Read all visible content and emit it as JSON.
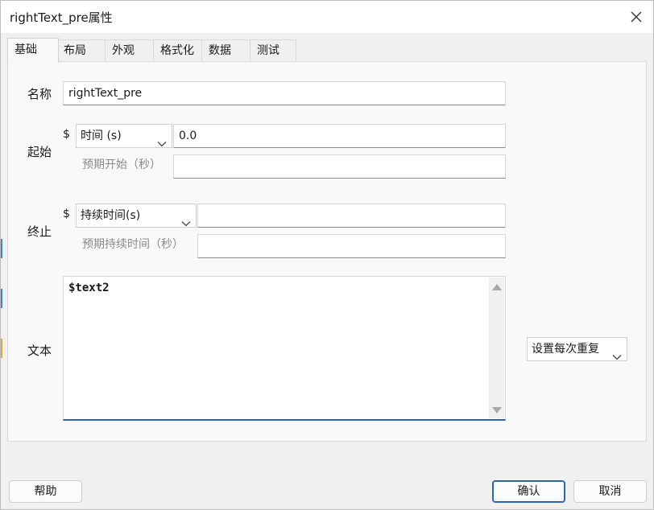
{
  "window": {
    "title": "rightText_pre属性"
  },
  "tabs": [
    {
      "label": "基础",
      "active": true
    },
    {
      "label": "布局"
    },
    {
      "label": "外观"
    },
    {
      "label": "格式化"
    },
    {
      "label": "数据"
    },
    {
      "label": "测试"
    }
  ],
  "fields": {
    "name": {
      "label": "名称",
      "value": "rightText_pre"
    },
    "start": {
      "label": "起始",
      "dollar": "$",
      "type_selected": "时间 (s)",
      "value": "0.0",
      "expected_label": "预期开始（秒）",
      "expected_value": ""
    },
    "stop": {
      "label": "终止",
      "dollar": "$",
      "type_selected": "持续时间(s)",
      "value": "",
      "expected_label": "预期持续时间（秒）",
      "expected_value": ""
    },
    "text": {
      "label": "文本",
      "value": "$text2",
      "repeat_selected": "设置每次重复"
    }
  },
  "buttons": {
    "help": "帮助",
    "ok": "确认",
    "cancel": "取消"
  },
  "colors": {
    "accent": "#2a64b4",
    "panel": "#f9f9f9",
    "background": "#f0f0f0"
  }
}
